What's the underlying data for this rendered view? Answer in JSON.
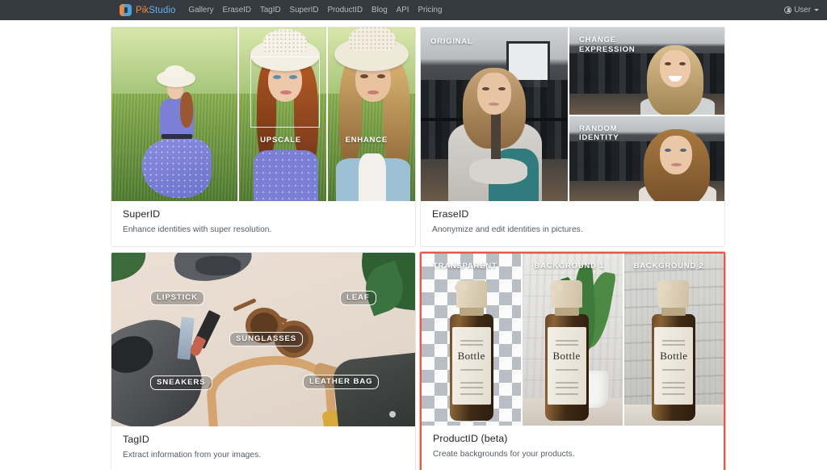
{
  "navbar": {
    "brand": {
      "prefix": "Pik",
      "suffix": "Studio"
    },
    "links": [
      "Gallery",
      "EraseID",
      "TagID",
      "SuperID",
      "ProductID",
      "Blog",
      "API",
      "Pricing"
    ],
    "user": {
      "label": "User"
    },
    "background_color": "#343a40",
    "brand_colors": {
      "orange": "#f0883e",
      "blue": "#6ab0e8"
    }
  },
  "cards": [
    {
      "id": "superid",
      "title": "SuperID",
      "description": "Enhance identities with super resolution.",
      "highlighted": false,
      "panel_labels": [
        "",
        "UPSCALE",
        "ENHANCE"
      ]
    },
    {
      "id": "eraseid",
      "title": "EraseID",
      "description": "Anonymize and edit identities in pictures.",
      "highlighted": false,
      "panel_labels": [
        "ORIGINAL",
        "CHANGE\nEXPRESSION",
        "RANDOM\nIDENTITY"
      ],
      "panel_label_original": "ORIGINAL",
      "panel_label_change_line1": "CHANGE",
      "panel_label_change_line2": "EXPRESSION",
      "panel_label_random_line1": "RANDOM",
      "panel_label_random_line2": "IDENTITY"
    },
    {
      "id": "tagid",
      "title": "TagID",
      "description": "Extract information from your images.",
      "highlighted": false,
      "tags": [
        "LIPSTICK",
        "LEAF",
        "SUNGLASSES",
        "SNEAKERS",
        "LEATHER BAG"
      ]
    },
    {
      "id": "productid",
      "title": "ProductID (beta)",
      "description": "Create backgrounds for your products.",
      "highlighted": true,
      "highlight_color": "#e8584a",
      "panel_labels": [
        "TRANSPARENT",
        "BACKGROUND 1",
        "BACKGROUND 2"
      ],
      "bottle_label": "Bottle"
    }
  ]
}
